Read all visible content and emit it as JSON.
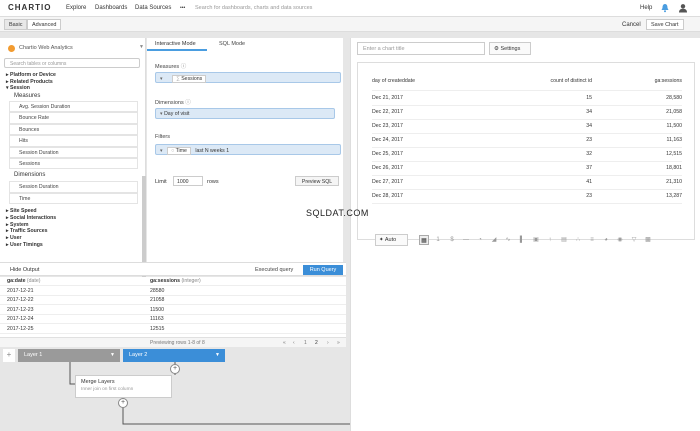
{
  "topnav": {
    "logo": "CHARTIO",
    "links": [
      "Explore",
      "Dashboards",
      "Data Sources"
    ],
    "more": "•••",
    "search_placeholder": "Search for dashboards, charts and data sources",
    "help": "Help"
  },
  "modebar": {
    "basic": "Basic",
    "advanced": "Advanced",
    "cancel": "Cancel",
    "save": "Save Chart"
  },
  "datasource": {
    "name": "Chartio Web Analytics",
    "search_placeholder": "Search tables or columns"
  },
  "tree": {
    "nodes_top": [
      "▸ Platform or Device",
      "▸ Related Products",
      "▾ Session"
    ],
    "section_measures": "Measures",
    "measures": [
      "Avg. Session Duration",
      "Bounce Rate",
      "Bounces",
      "Hits",
      "Session Duration",
      "Sessions"
    ],
    "section_dimensions": "Dimensions",
    "dimensions": [
      "Session Duration",
      "Time"
    ],
    "nodes_bottom": [
      "▸ Site Speed",
      "▸ Social Interactions",
      "▸ System",
      "▸ Traffic Sources",
      "▸ User",
      "▸ User Timings"
    ]
  },
  "editor": {
    "tab_interactive": "Interactive Mode",
    "tab_sql": "SQL Mode",
    "measures_label": "Measures",
    "measure_pill": "Sessions",
    "dimensions_label": "Dimensions",
    "dimension_pill": "Day of visit",
    "filters_label": "Filters",
    "filter_field": "Time",
    "filter_value": "last N weeks 1",
    "limit_label": "Limit",
    "limit_value": "1000",
    "rows_label": "rows",
    "preview_sql": "Preview SQL"
  },
  "results": {
    "hide_output": "Hide Output",
    "executed_query": "Executed query",
    "run_query": "Run Query",
    "col1": "ga:date",
    "col1_type": "(date)",
    "col2": "ga:sessions",
    "col2_type": "(integer)",
    "rows": [
      [
        "2017-12-21",
        "28580"
      ],
      [
        "2017-12-22",
        "21058"
      ],
      [
        "2017-12-23",
        "11500"
      ],
      [
        "2017-12-24",
        "11163"
      ],
      [
        "2017-12-25",
        "12515"
      ]
    ],
    "pager_text": "Previewing rows 1-8 of 8",
    "pages": [
      "«",
      "‹",
      "1",
      "2",
      "›",
      "»"
    ]
  },
  "layers": {
    "layer1": "Layer 1",
    "layer2": "Layer 2",
    "merge_title": "Merge Layers",
    "merge_sub": "Inner join on first column"
  },
  "chart": {
    "title_placeholder": "Enter a chart title",
    "settings": "Settings",
    "headers": [
      "day of createddate",
      "count of distinct id",
      "ga:sessions"
    ],
    "rows": [
      [
        "Dec 21, 2017",
        "15",
        "28,580"
      ],
      [
        "Dec 22, 2017",
        "34",
        "21,058"
      ],
      [
        "Dec 23, 2017",
        "34",
        "11,500"
      ],
      [
        "Dec 24, 2017",
        "23",
        "11,163"
      ],
      [
        "Dec 25, 2017",
        "32",
        "12,515"
      ],
      [
        "Dec 26, 2017",
        "37",
        "18,801"
      ],
      [
        "Dec 27, 2017",
        "41",
        "21,310"
      ],
      [
        "Dec 28, 2017",
        "23",
        "13,287"
      ]
    ],
    "auto": "Auto"
  },
  "watermark": "SQLDAT.COM"
}
